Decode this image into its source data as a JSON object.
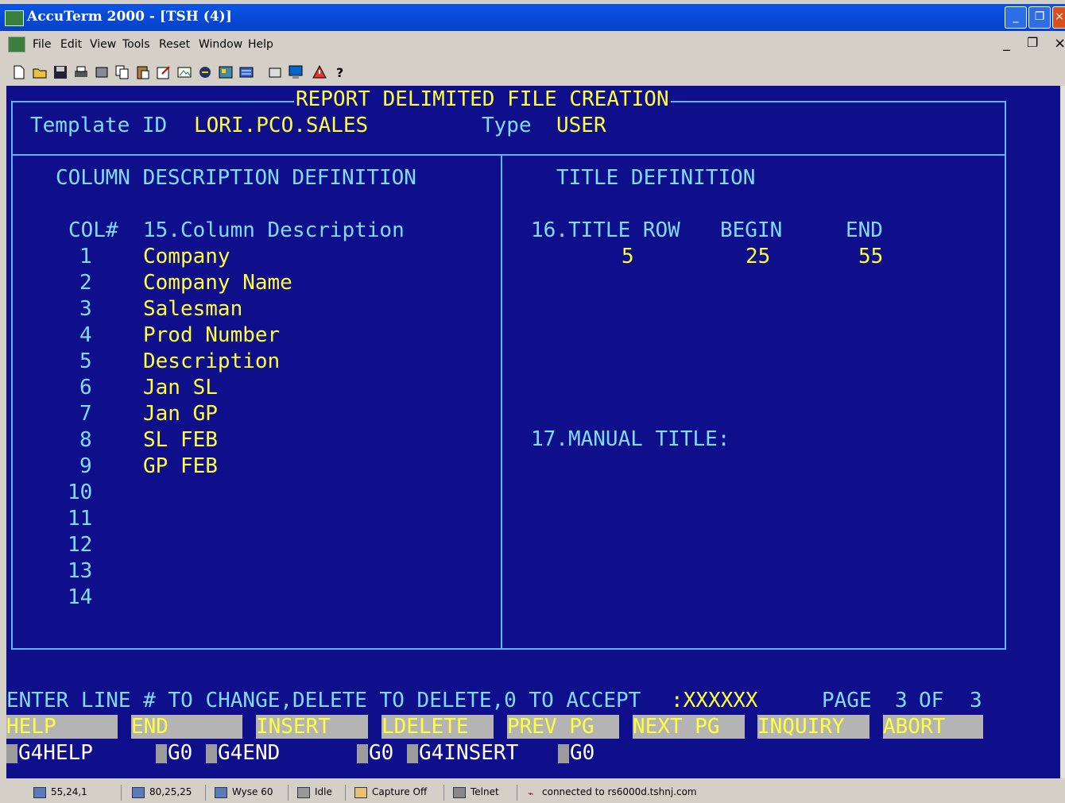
{
  "window": {
    "title": "AccuTerm 2000 - [TSH (4)]"
  },
  "menu": [
    "File",
    "Edit",
    "View",
    "Tools",
    "Reset",
    "Window",
    "Help"
  ],
  "toolbar_icons": [
    "new-icon",
    "open-icon",
    "save-icon",
    "print-icon",
    "disk-icon",
    "copy-icon",
    "paste-icon",
    "edit-icon",
    "capture-icon",
    "script-icon",
    "settings-icon",
    "link-icon",
    "mail-icon",
    "monitor-icon",
    "alert-icon",
    "help-icon"
  ],
  "screen": {
    "header_title": "REPORT DELIMITED FILE CREATION",
    "template_label": "Template ID",
    "template_value": "LORI.PCO.SALES",
    "type_label": "Type",
    "type_value": "USER",
    "left_section_title": "COLUMN DESCRIPTION DEFINITION",
    "col_header": "COL#",
    "desc_header": "15.Column Description",
    "rows": [
      {
        "num": "1",
        "desc": "Company"
      },
      {
        "num": "2",
        "desc": "Company Name"
      },
      {
        "num": "3",
        "desc": "Salesman"
      },
      {
        "num": "4",
        "desc": "Prod Number"
      },
      {
        "num": "5",
        "desc": "Description"
      },
      {
        "num": "6",
        "desc": "Jan SL"
      },
      {
        "num": "7",
        "desc": "Jan GP"
      },
      {
        "num": "8",
        "desc": "SL FEB"
      },
      {
        "num": "9",
        "desc": "GP FEB"
      },
      {
        "num": "10",
        "desc": ""
      },
      {
        "num": "11",
        "desc": ""
      },
      {
        "num": "12",
        "desc": ""
      },
      {
        "num": "13",
        "desc": ""
      },
      {
        "num": "14",
        "desc": ""
      }
    ],
    "right_section_title": "TITLE DEFINITION",
    "title_row_header": "16.TITLE ROW",
    "begin_header": "BEGIN",
    "end_header": "END",
    "title_row_value": "5",
    "begin_value": "25",
    "end_value": "55",
    "manual_title_label": "17.MANUAL TITLE:",
    "prompt_text": "ENTER LINE # TO CHANGE,DELETE TO DELETE,0 TO ACCEPT",
    "prompt_input": ":XXXXXX",
    "page_label": "PAGE",
    "page_current": "3",
    "page_of": "OF",
    "page_total": "3",
    "function_keys": [
      "HELP",
      "END",
      "INSERT",
      "LDELETE",
      "PREV PG",
      "NEXT PG",
      "INQUIRY",
      "ABORT"
    ],
    "g4_keys": [
      "G4HELP",
      "G0",
      "G4END",
      "G0",
      "G4INSERT",
      "G0"
    ]
  },
  "status": {
    "cursor": "55,24,1",
    "size": "80,25,25",
    "terminal": "Wyse 60",
    "print_state": "Idle",
    "capture": "Capture Off",
    "protocol": "Telnet",
    "connection": "connected to rs6000d.tshnj.com"
  }
}
